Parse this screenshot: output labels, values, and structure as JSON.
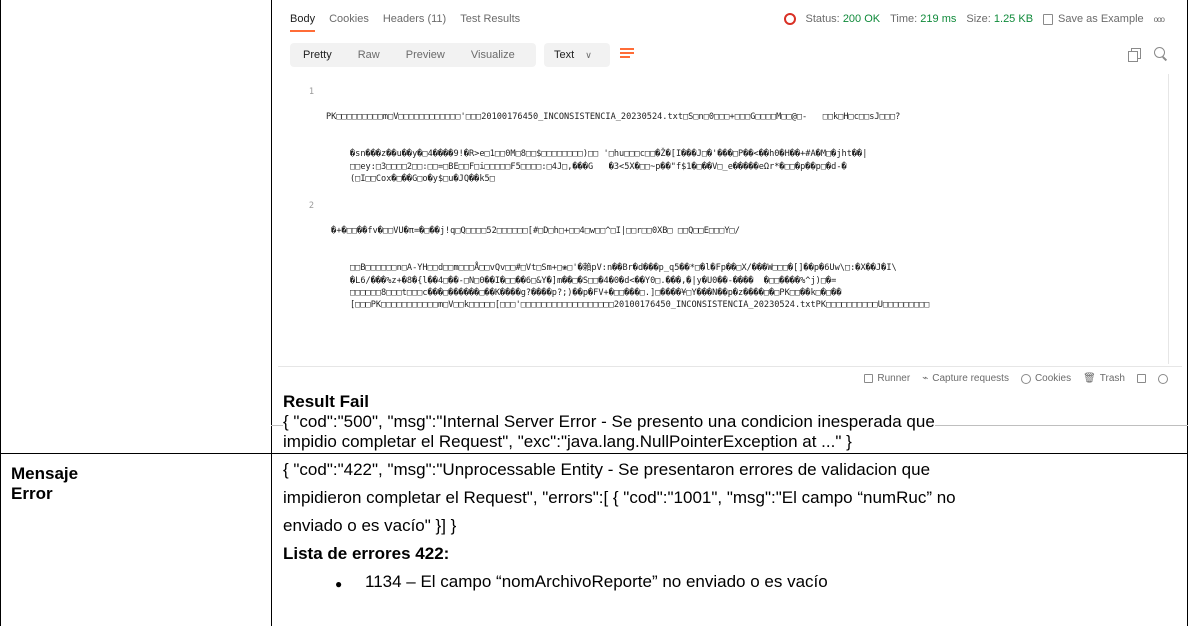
{
  "postman": {
    "tabs": [
      "Body",
      "Cookies",
      "Headers (11)",
      "Test Results"
    ],
    "status": {
      "status_label": "Status:",
      "status_value": "200 OK",
      "time_label": "Time:",
      "time_value": "219 ms",
      "size_label": "Size:",
      "size_value": "1.25 KB",
      "save_label": "Save as Example",
      "more": "ooo"
    },
    "views": [
      "Pretty",
      "Raw",
      "Preview",
      "Visualize"
    ],
    "format": "Text",
    "code_lines": [
      {
        "num": "1",
        "text": "PK□□□□□□□□□m□V□□□□□□□□□□□□'□□□20100176450_INCONSISTENCIA_20230524.txt□S□n□0□□□+□□□G□□□□M□□@□-   □□k□H□c□□sJ□□□?",
        "cont": [
          "�sn���z��u��y�□4����9!�R>e□1□□0M□8□□$□□□□□□□□)□□ '□hu□□□c□□�Ž�[I���J□�'���□P��<��h0�H��+#A�M□�jht��|",
          "□□ey:□3□□□□2□□:□□=□BE□□F□i□□□□□F5□□□□:□4J□,���G   �3<5X�□□~p��\"f$1�□��V□_e�����eΩr*�□□�p��p□�d-�",
          "(□I□□Cox�□��G□o�y$□u�JQ��k5□"
        ]
      },
      {
        "num": "2",
        "text": " �+�□□��fv�□□VU�π=�□��j!q□Q□□□□52□□□□□□[#□D□h□+□□4□w□□^□I|□□r□□0XB□ □□Q□□E□□□Y□/",
        "cont": [
          "□□B□□□□□□n□A-YH□□d□□m□□□Å□□vQv□□#□Vt□Sm+□❀□'�賴pV:n��Br�d���p_q5��*□�l�Fp��□X/���W□□□�[]��p�6Uw\\□:�X��J�I\\",
          "�L6/���%z+�8�{l��4□��-□N□0��I�□□��6□&Y�]m��□�S□□�4�0�d<��Y0□.���,�|y�U0��-����  �□□����%^j)□�=",
          "□□□□□□8□□□t□□□c���□������□��K����g?����p?;)��p�FV+�□□���□.]□����¥□Y���N��p�z����□�□PK□□��k□�□��",
          "[□□□PK□□□□□□□□□□□m□V□□k□□□□□[□□□'□□□□□□□□□□□□□□□□□□20100176450_INCONSISTENCIA_20230524.txtPK□□□□□□□□□□U□□□□□□□□□"
        ]
      }
    ],
    "footer": [
      "Runner",
      "Capture requests",
      "Cookies",
      "Trash"
    ]
  },
  "result_fail": {
    "heading": "Result Fail",
    "lines": [
      "{ \"cod\":\"500\", \"msg\":\"Internal Server Error - Se presento una condicion inesperada que",
      "impidio completar el Request\", \"exc\":\"java.lang.NullPointerException at ...\" }"
    ]
  },
  "mensaje_error": {
    "label": "Mensaje Error",
    "lines": [
      "{ \"cod\":\"422\", \"msg\":\"Unprocessable Entity - Se presentaron errores de validacion que",
      "impidieron completar el Request\", \"errors\":[ { \"cod\":\"1001\", \"msg\":\"El campo “numRuc” no",
      "enviado o es vacío\" }] }"
    ],
    "list_heading": "Lista de errores 422:",
    "bullets": [
      "1134 – El campo “nomArchivoReporte” no enviado o es vacío"
    ]
  }
}
